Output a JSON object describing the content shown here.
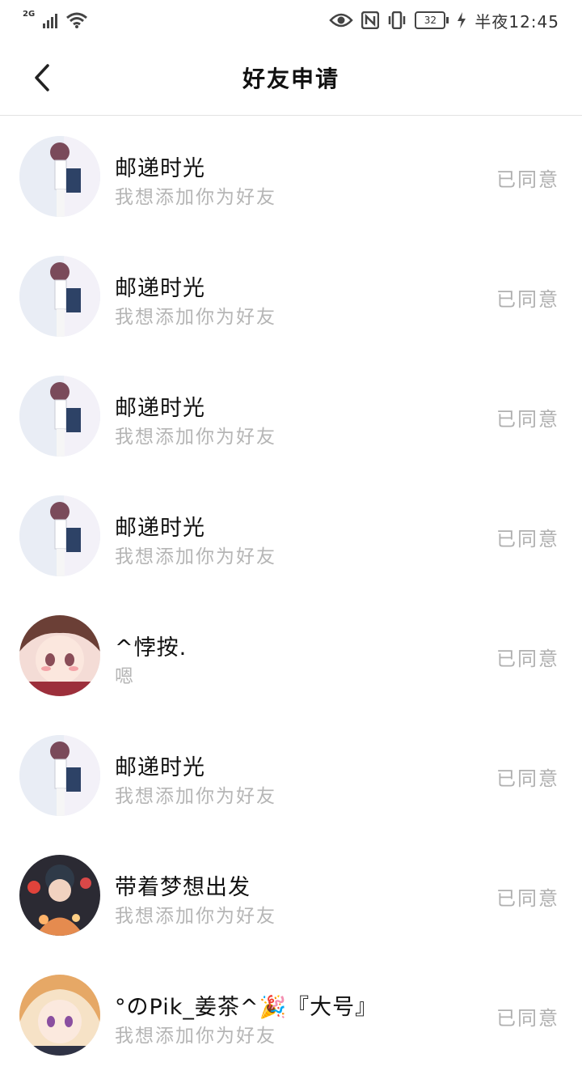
{
  "status_bar": {
    "network": "2G",
    "battery": "32",
    "time": "半夜12:45"
  },
  "header": {
    "title": "好友申请"
  },
  "requests": [
    {
      "name": "邮递时光",
      "message": "我想添加你为好友",
      "status": "已同意",
      "avatar": "boy-anime"
    },
    {
      "name": "邮递时光",
      "message": "我想添加你为好友",
      "status": "已同意",
      "avatar": "boy-anime"
    },
    {
      "name": "邮递时光",
      "message": "我想添加你为好友",
      "status": "已同意",
      "avatar": "boy-anime"
    },
    {
      "name": "邮递时光",
      "message": "我想添加你为好友",
      "status": "已同意",
      "avatar": "boy-anime"
    },
    {
      "name": "^悖按.",
      "message": "嗯",
      "status": "已同意",
      "avatar": "girl-blush"
    },
    {
      "name": "邮递时光",
      "message": "我想添加你为好友",
      "status": "已同意",
      "avatar": "boy-anime"
    },
    {
      "name": "带着梦想出发",
      "message": "我想添加你为好友",
      "status": "已同意",
      "avatar": "city-lights"
    },
    {
      "name": "°のPik_姜茶^🎉『大号』",
      "message": "我想添加你为好友",
      "status": "已同意",
      "avatar": "girl-blonde"
    }
  ]
}
